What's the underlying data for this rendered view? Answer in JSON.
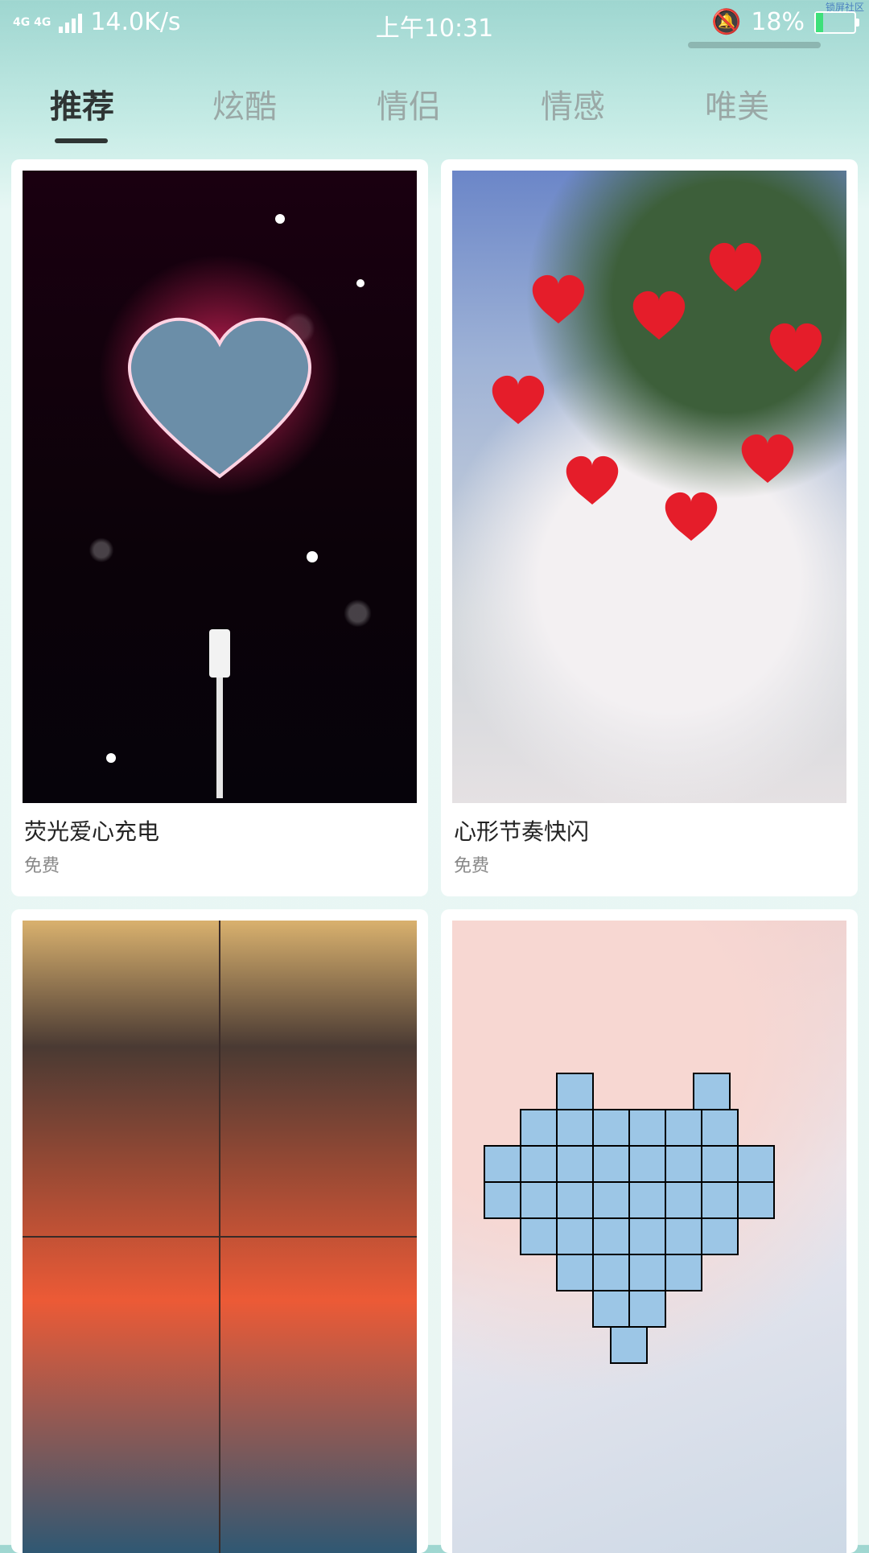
{
  "status_bar": {
    "network_badge_top": "4G 4G",
    "speed": "14.0K/s",
    "time": "上午10:31",
    "battery_percent": "18%",
    "battery_level": 0.18,
    "watermark": "锁屏社区"
  },
  "tabs": [
    {
      "label": "推荐",
      "active": true
    },
    {
      "label": "炫酷",
      "active": false
    },
    {
      "label": "情侣",
      "active": false
    },
    {
      "label": "情感",
      "active": false
    },
    {
      "label": "唯美",
      "active": false
    }
  ],
  "cards": [
    {
      "title": "荧光爱心充电",
      "price": "免费"
    },
    {
      "title": "心形节奏快闪",
      "price": "免费"
    },
    {
      "title": "",
      "price": ""
    },
    {
      "title": "",
      "price": ""
    }
  ],
  "colors": {
    "accent": "#2f3534",
    "battery_fill": "#3ee07a",
    "tab_inactive": "#9aa8a6"
  }
}
